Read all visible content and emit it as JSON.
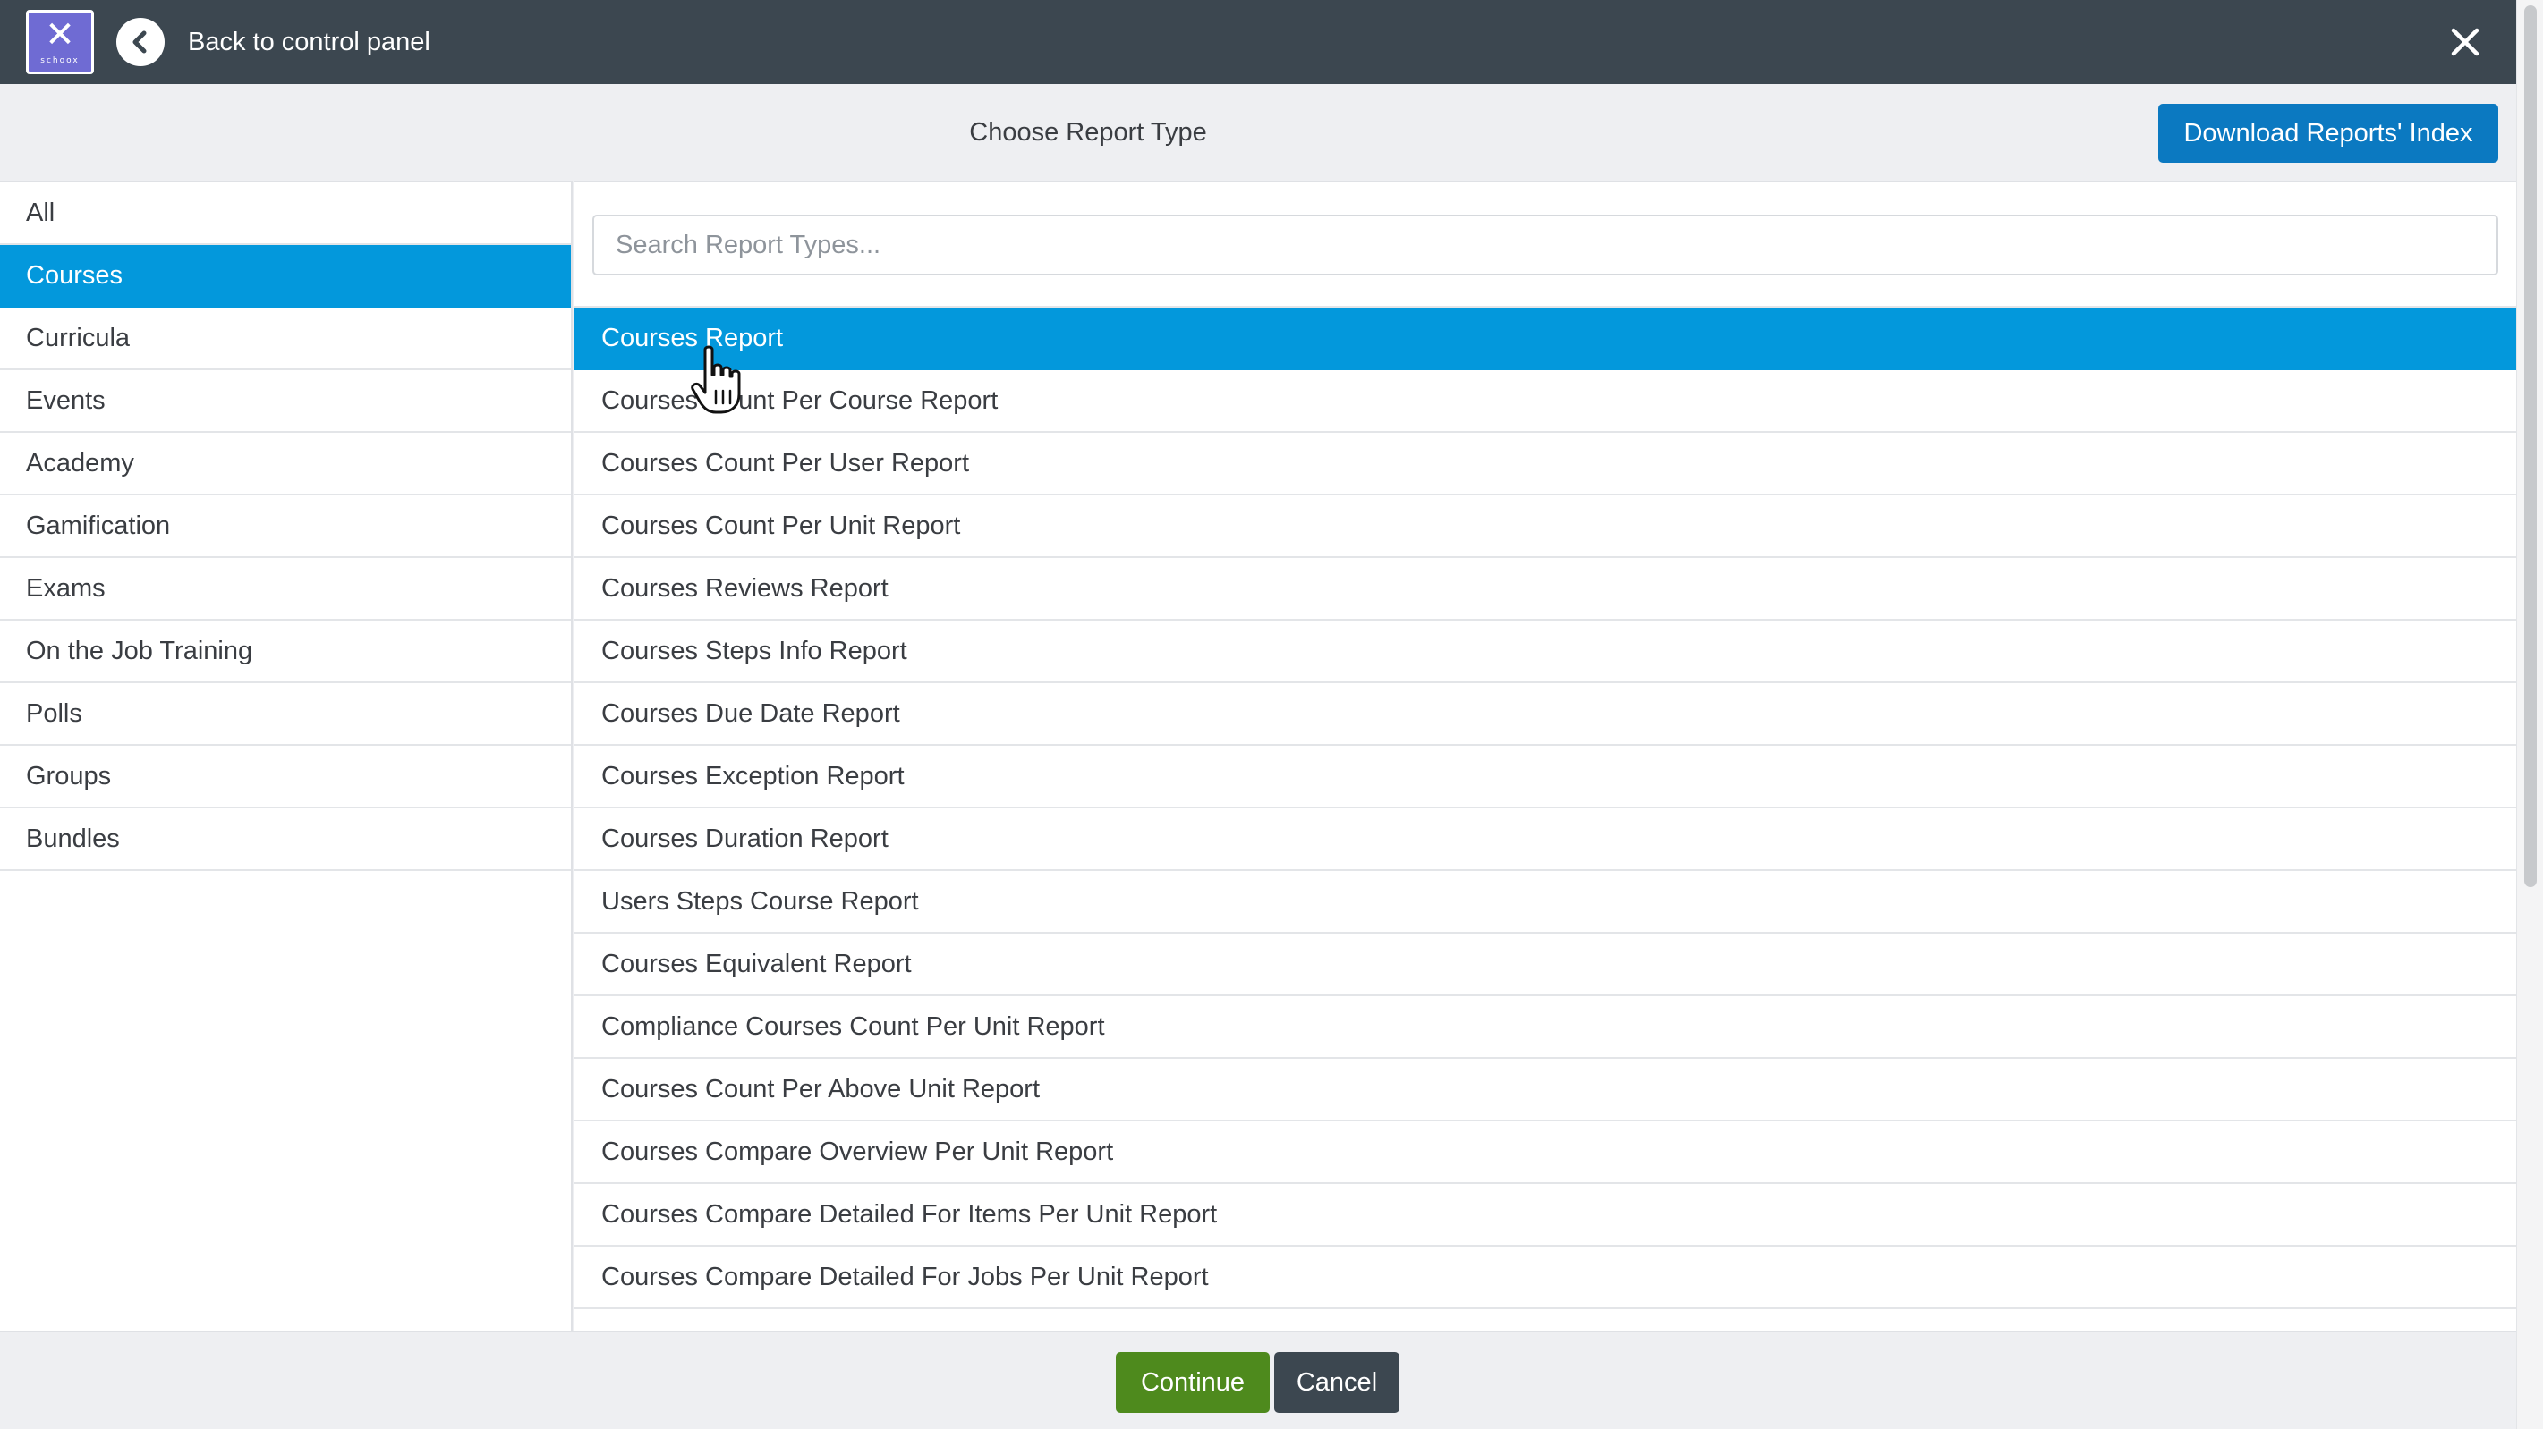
{
  "topbar": {
    "logo_text": "schoox",
    "back_label": "Back to control panel"
  },
  "header": {
    "title": "Choose Report Type",
    "download_label": "Download Reports' Index"
  },
  "categories": [
    {
      "label": "All",
      "active": false
    },
    {
      "label": "Courses",
      "active": true
    },
    {
      "label": "Curricula",
      "active": false
    },
    {
      "label": "Events",
      "active": false
    },
    {
      "label": "Academy",
      "active": false
    },
    {
      "label": "Gamification",
      "active": false
    },
    {
      "label": "Exams",
      "active": false
    },
    {
      "label": "On the Job Training",
      "active": false
    },
    {
      "label": "Polls",
      "active": false
    },
    {
      "label": "Groups",
      "active": false
    },
    {
      "label": "Bundles",
      "active": false
    }
  ],
  "search": {
    "placeholder": "Search Report Types...",
    "value": ""
  },
  "reports": [
    {
      "label": "Courses Report",
      "active": true
    },
    {
      "label": "Courses Count Per Course Report",
      "active": false
    },
    {
      "label": "Courses Count Per User Report",
      "active": false
    },
    {
      "label": "Courses Count Per Unit Report",
      "active": false
    },
    {
      "label": "Courses Reviews Report",
      "active": false
    },
    {
      "label": "Courses Steps Info Report",
      "active": false
    },
    {
      "label": "Courses Due Date Report",
      "active": false
    },
    {
      "label": "Courses Exception Report",
      "active": false
    },
    {
      "label": "Courses Duration Report",
      "active": false
    },
    {
      "label": "Users Steps Course Report",
      "active": false
    },
    {
      "label": "Courses Equivalent Report",
      "active": false
    },
    {
      "label": "Compliance Courses Count Per Unit Report",
      "active": false
    },
    {
      "label": "Courses Count Per Above Unit Report",
      "active": false
    },
    {
      "label": "Courses Compare Overview Per Unit Report",
      "active": false
    },
    {
      "label": "Courses Compare Detailed For Items Per Unit Report",
      "active": false
    },
    {
      "label": "Courses Compare Detailed For Jobs Per Unit Report",
      "active": false
    }
  ],
  "footer": {
    "continue_label": "Continue",
    "cancel_label": "Cancel"
  },
  "colors": {
    "topbar": "#3c4750",
    "accent": "#0398dc",
    "download_button": "#0b79c1",
    "continue_button": "#4e8a1d",
    "cancel_button": "#3c4750",
    "logo": "#6f6bd3"
  },
  "icons": {
    "logo": "schoox-logo-icon",
    "back": "chevron-left-icon",
    "close": "close-icon",
    "cursor": "hand-pointer-icon"
  }
}
